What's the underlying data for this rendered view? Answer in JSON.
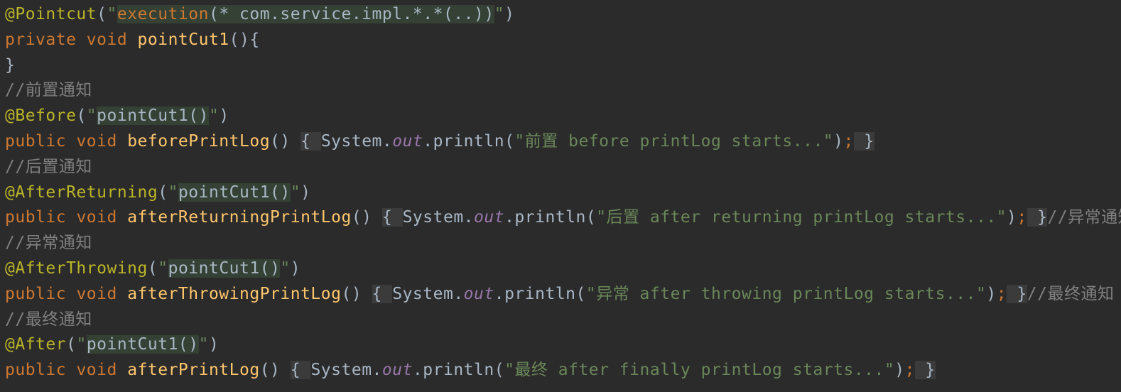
{
  "lines": [
    {
      "name": "pointcut-annotation-line",
      "tokens": [
        {
          "text": "@Pointcut",
          "cls": "annotation"
        },
        {
          "text": "(",
          "cls": "plain"
        },
        {
          "text": "\"",
          "cls": "string"
        },
        {
          "text": "execution",
          "cls": "lit-in hl"
        },
        {
          "text": "(* com.service.impl.*.*(..))",
          "cls": "plain hl"
        },
        {
          "text": "\"",
          "cls": "string"
        },
        {
          "text": ")",
          "cls": "plain"
        }
      ]
    },
    {
      "name": "pointcut-method-line",
      "tokens": [
        {
          "text": "private ",
          "cls": "keyword"
        },
        {
          "text": "void ",
          "cls": "keyword"
        },
        {
          "text": "pointCut1",
          "cls": "method"
        },
        {
          "text": "(){",
          "cls": "plain"
        }
      ]
    },
    {
      "name": "closing-brace-line",
      "tokens": [
        {
          "text": "}",
          "cls": "plain"
        }
      ]
    },
    {
      "name": "before-comment-line",
      "tokens": [
        {
          "text": "//前置通知",
          "cls": "comment"
        }
      ]
    },
    {
      "name": "before-annotation-line",
      "tokens": [
        {
          "text": "@Before",
          "cls": "annotation"
        },
        {
          "text": "(",
          "cls": "plain"
        },
        {
          "text": "\"",
          "cls": "string"
        },
        {
          "text": "pointCut1()",
          "cls": "plain hl"
        },
        {
          "text": "\"",
          "cls": "string"
        },
        {
          "text": ")",
          "cls": "plain"
        }
      ]
    },
    {
      "name": "before-method-line",
      "tokens": [
        {
          "text": "public ",
          "cls": "keyword"
        },
        {
          "text": "void ",
          "cls": "keyword"
        },
        {
          "text": "beforePrintLog",
          "cls": "method"
        },
        {
          "text": "() ",
          "cls": "plain"
        },
        {
          "text": "{ ",
          "cls": "fold"
        },
        {
          "text": "System.",
          "cls": "plain"
        },
        {
          "text": "out",
          "cls": "static-field"
        },
        {
          "text": ".println(",
          "cls": "plain"
        },
        {
          "text": "\"前置 before printLog starts...\"",
          "cls": "string"
        },
        {
          "text": ")",
          "cls": "plain"
        },
        {
          "text": ";",
          "cls": "semi"
        },
        {
          "text": " }",
          "cls": "fold"
        }
      ]
    },
    {
      "name": "after-returning-comment-line",
      "tokens": [
        {
          "text": "//后置通知",
          "cls": "comment"
        }
      ]
    },
    {
      "name": "after-returning-annotation-line",
      "tokens": [
        {
          "text": "@AfterReturning",
          "cls": "annotation"
        },
        {
          "text": "(",
          "cls": "plain"
        },
        {
          "text": "\"",
          "cls": "string"
        },
        {
          "text": "pointCut1()",
          "cls": "plain hl"
        },
        {
          "text": "\"",
          "cls": "string"
        },
        {
          "text": ")",
          "cls": "plain"
        }
      ]
    },
    {
      "name": "after-returning-method-line",
      "tokens": [
        {
          "text": "public ",
          "cls": "keyword"
        },
        {
          "text": "void ",
          "cls": "keyword"
        },
        {
          "text": "afterReturningPrintLog",
          "cls": "method"
        },
        {
          "text": "() ",
          "cls": "plain"
        },
        {
          "text": "{ ",
          "cls": "fold"
        },
        {
          "text": "System.",
          "cls": "plain"
        },
        {
          "text": "out",
          "cls": "static-field"
        },
        {
          "text": ".println(",
          "cls": "plain"
        },
        {
          "text": "\"后置 after returning printLog starts...\"",
          "cls": "string"
        },
        {
          "text": ")",
          "cls": "plain"
        },
        {
          "text": ";",
          "cls": "semi"
        },
        {
          "text": " }",
          "cls": "fold"
        },
        {
          "text": "//异常通知",
          "cls": "comment"
        }
      ]
    },
    {
      "name": "after-throwing-comment-line",
      "tokens": [
        {
          "text": "//异常通知",
          "cls": "comment"
        }
      ]
    },
    {
      "name": "after-throwing-annotation-line",
      "tokens": [
        {
          "text": "@AfterThrowing",
          "cls": "annotation"
        },
        {
          "text": "(",
          "cls": "plain"
        },
        {
          "text": "\"",
          "cls": "string"
        },
        {
          "text": "pointCut1()",
          "cls": "plain hl"
        },
        {
          "text": "\"",
          "cls": "string"
        },
        {
          "text": ")",
          "cls": "plain"
        }
      ]
    },
    {
      "name": "after-throwing-method-line",
      "tokens": [
        {
          "text": "public ",
          "cls": "keyword"
        },
        {
          "text": "void ",
          "cls": "keyword"
        },
        {
          "text": "afterThrowingPrintLog",
          "cls": "method"
        },
        {
          "text": "() ",
          "cls": "plain"
        },
        {
          "text": "{ ",
          "cls": "fold"
        },
        {
          "text": "System.",
          "cls": "plain"
        },
        {
          "text": "out",
          "cls": "static-field"
        },
        {
          "text": ".println(",
          "cls": "plain"
        },
        {
          "text": "\"异常 after throwing printLog starts...\"",
          "cls": "string"
        },
        {
          "text": ")",
          "cls": "plain"
        },
        {
          "text": ";",
          "cls": "semi"
        },
        {
          "text": " }",
          "cls": "fold"
        },
        {
          "text": "//最终通知",
          "cls": "comment"
        }
      ]
    },
    {
      "name": "after-comment-line",
      "tokens": [
        {
          "text": "//最终通知",
          "cls": "comment"
        }
      ]
    },
    {
      "name": "after-annotation-line",
      "tokens": [
        {
          "text": "@After",
          "cls": "annotation"
        },
        {
          "text": "(",
          "cls": "plain"
        },
        {
          "text": "\"",
          "cls": "string"
        },
        {
          "text": "pointCut1()",
          "cls": "plain hl"
        },
        {
          "text": "\"",
          "cls": "string"
        },
        {
          "text": ")",
          "cls": "plain"
        }
      ]
    },
    {
      "name": "after-method-line",
      "tokens": [
        {
          "text": "public ",
          "cls": "keyword"
        },
        {
          "text": "void ",
          "cls": "keyword"
        },
        {
          "text": "afterPrintLog",
          "cls": "method"
        },
        {
          "text": "() ",
          "cls": "plain"
        },
        {
          "text": "{ ",
          "cls": "fold"
        },
        {
          "text": "System.",
          "cls": "plain"
        },
        {
          "text": "out",
          "cls": "static-field"
        },
        {
          "text": ".println(",
          "cls": "plain"
        },
        {
          "text": "\"最终 after finally printLog starts...\"",
          "cls": "string"
        },
        {
          "text": ")",
          "cls": "plain"
        },
        {
          "text": ";",
          "cls": "semi"
        },
        {
          "text": " }",
          "cls": "fold"
        }
      ]
    }
  ],
  "colors": {
    "background": "#2b2b2b",
    "annotation": "#bbb529",
    "keyword": "#cc7832",
    "method": "#ffc66d",
    "string": "#6a8759",
    "comment": "#808080",
    "default_text": "#a9b7c6",
    "static_field": "#9876aa",
    "injected_language_highlight": "#344134",
    "folded_region": "#3b3b3b"
  }
}
